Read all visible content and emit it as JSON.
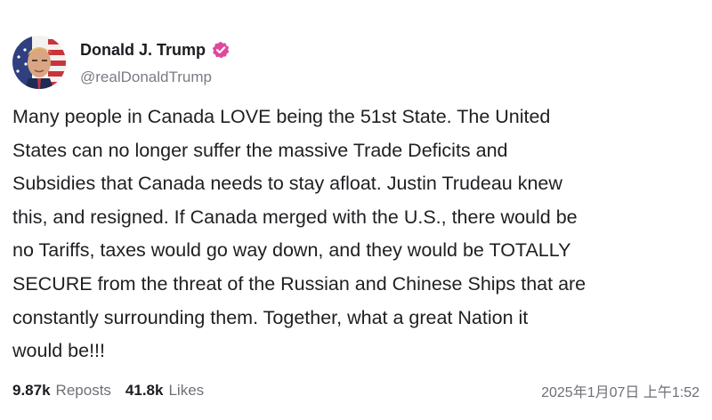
{
  "post": {
    "author": {
      "display_name": "Donald J. Trump",
      "handle": "@realDonaldTrump",
      "verified_icon": "verified-badge-icon",
      "badge_color": "#e0499b"
    },
    "body": "Many people in Canada LOVE being the 51st State. The United\nStates can no longer suffer the massive Trade Deficits and\nSubsidies that Canada needs to stay afloat. Justin Trudeau knew\nthis, and resigned. If Canada merged with the U.S., there would be\nno Tariffs, taxes would go way down, and they would be TOTALLY\nSECURE from the threat of the Russian and Chinese Ships that are\nconstantly surrounding them. Together, what a great Nation it\nwould be!!!",
    "stats": {
      "reposts_count": "9.87k",
      "reposts_label": "Reposts",
      "likes_count": "41.8k",
      "likes_label": "Likes"
    },
    "timestamp": "2025年1月07日 上午1:52"
  }
}
